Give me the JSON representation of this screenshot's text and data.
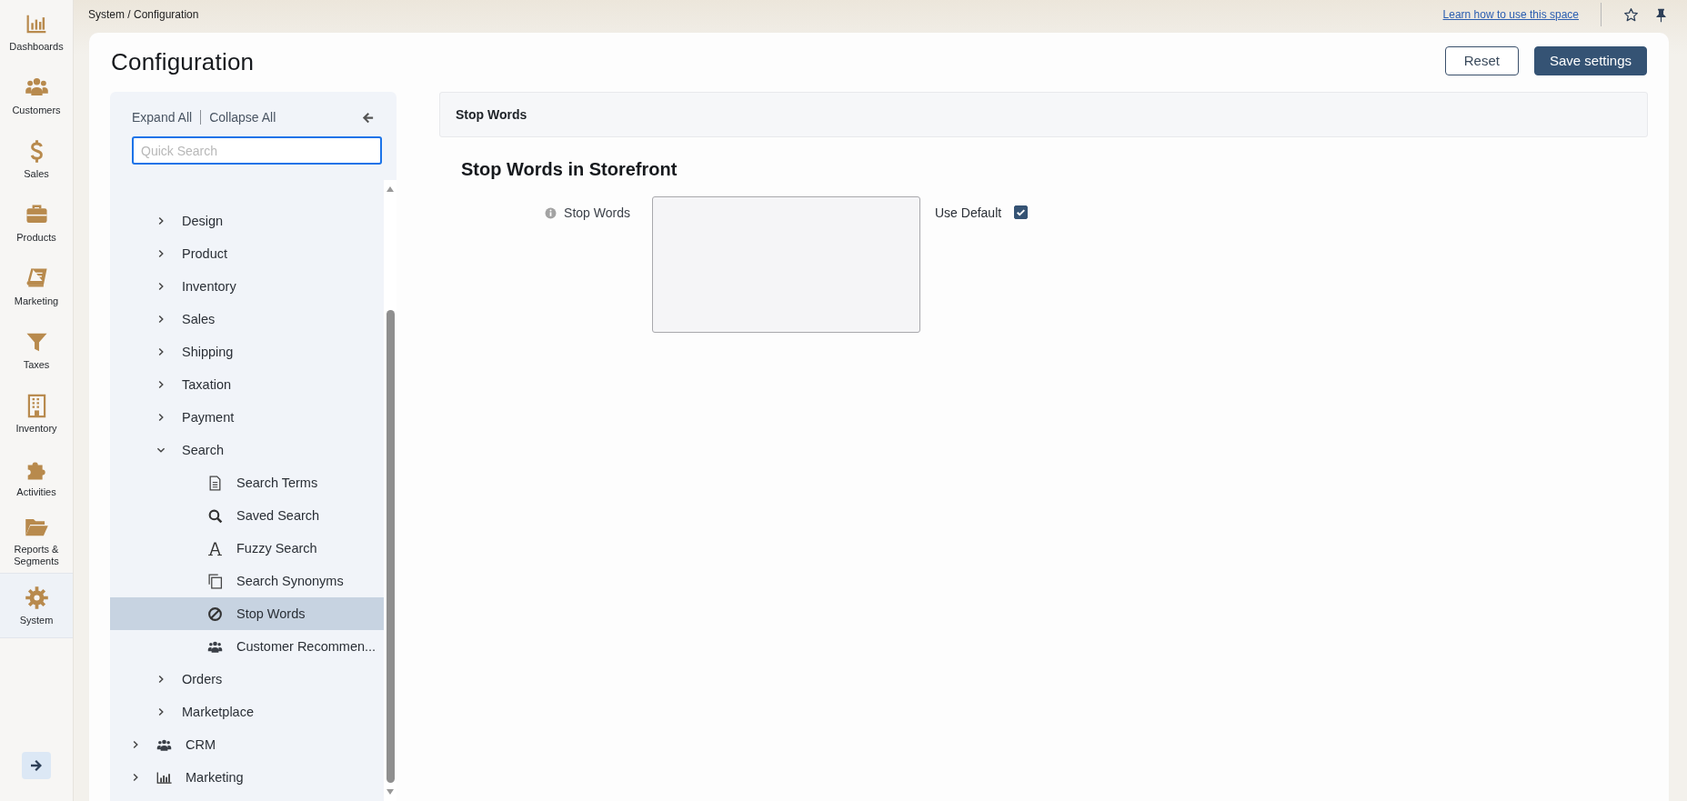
{
  "nav": {
    "items": [
      {
        "label": "Dashboards",
        "kind": "chart",
        "selected": false
      },
      {
        "label": "Customers",
        "kind": "users",
        "selected": false
      },
      {
        "label": "Sales",
        "kind": "dollar",
        "selected": false
      },
      {
        "label": "Products",
        "kind": "briefcase",
        "selected": false
      },
      {
        "label": "Marketing",
        "kind": "book",
        "selected": false
      },
      {
        "label": "Taxes",
        "kind": "filter",
        "selected": false
      },
      {
        "label": "Inventory",
        "kind": "building",
        "selected": false
      },
      {
        "label": "Activities",
        "kind": "puzzle",
        "selected": false
      },
      {
        "label": "Reports & Segments",
        "kind": "folder",
        "selected": false
      },
      {
        "label": "System",
        "kind": "gear",
        "selected": true
      }
    ]
  },
  "breadcrumb": "System / Configuration",
  "help_link": "Learn how to use this space",
  "page_title": "Configuration",
  "buttons": [
    {
      "label": "Reset",
      "kind": "secondary"
    },
    {
      "label": "Save settings",
      "kind": "primary"
    }
  ],
  "tree_panel": {
    "expand_all": "Expand All",
    "collapse_all": "Collapse All",
    "search": {
      "placeholder": "Quick Search"
    },
    "items": [
      {
        "children": [
          {
            "label": "Design",
            "expanded": false,
            "selected": false
          },
          {
            "label": "Product",
            "expanded": false,
            "selected": false
          },
          {
            "label": "Inventory",
            "expanded": false,
            "selected": false
          },
          {
            "label": "Sales",
            "expanded": false,
            "selected": false
          },
          {
            "label": "Shipping",
            "expanded": false,
            "selected": false
          },
          {
            "label": "Taxation",
            "expanded": false,
            "selected": false
          },
          {
            "label": "Payment",
            "expanded": false,
            "selected": false
          },
          {
            "label": "Search",
            "expanded": true,
            "selected": false,
            "children": [
              {
                "label": "Search Terms",
                "kind": "document",
                "selected": false
              },
              {
                "label": "Saved Search",
                "kind": "search",
                "selected": false
              },
              {
                "label": "Fuzzy Search",
                "kind": "font",
                "selected": false
              },
              {
                "label": "Search Synonyms",
                "kind": "copy",
                "selected": false
              },
              {
                "label": "Stop Words",
                "kind": "block",
                "selected": true
              },
              {
                "label": "Customer Recommen...",
                "kind": "users",
                "selected": false
              }
            ]
          },
          {
            "label": "Orders",
            "expanded": false,
            "selected": false
          },
          {
            "label": "Marketplace",
            "expanded": false,
            "selected": false
          }
        ]
      },
      {
        "label": "CRM",
        "kind": "users",
        "expanded": false,
        "selected": false
      },
      {
        "label": "Marketing",
        "kind": "chart",
        "expanded": false,
        "selected": false
      }
    ]
  },
  "section_header": "Stop Words",
  "section_title": "Stop Words in Storefront",
  "fields": [
    {
      "label": "Stop Words",
      "use_default_label": "Use Default",
      "use_default": true
    }
  ]
}
